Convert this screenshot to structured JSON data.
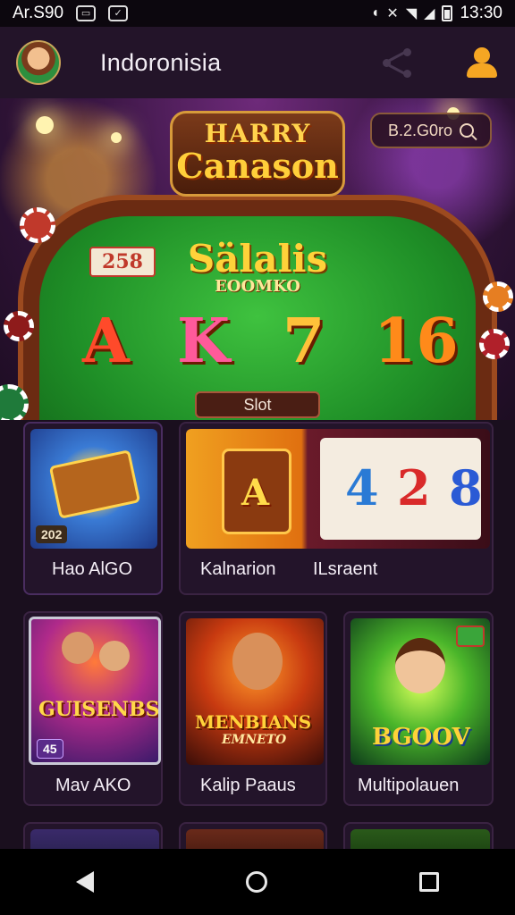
{
  "status_bar": {
    "carrier": "Ar.S90",
    "time": "13:30",
    "notif_icon_1": "gallery-icon",
    "notif_icon_2": "app-icon"
  },
  "header": {
    "title": "Indoronisia"
  },
  "hero": {
    "logo_line1": "HARRY",
    "logo_line2": "Canason",
    "balance": "B.2.G0ro",
    "jackpot_tag": "258",
    "felt_title": "Sälalis",
    "felt_subtitle": "EOOMKO",
    "symbols": [
      "A",
      "K",
      "7",
      "16"
    ],
    "slot_button": "Slot"
  },
  "games_row1": [
    {
      "label": "Hao AlGO",
      "badge": "202"
    },
    {
      "label": "Kalnarion",
      "thumb_letter": "A",
      "reels": [
        "4",
        "2",
        "8"
      ]
    },
    {
      "label": "ILsraent"
    }
  ],
  "games_row2": [
    {
      "label": "Mav AKO",
      "thumb_title": "GUISENBS",
      "badge": "45"
    },
    {
      "label": "Kalip Paaus",
      "thumb_title": "MENBIANS",
      "thumb_sub": "EMNETO"
    },
    {
      "label": "Multipolauen",
      "thumb_title": "BGOOV"
    }
  ],
  "colors": {
    "accent": "#f5a623",
    "felt": "#1f8f27",
    "background": "#1a0f1e"
  }
}
